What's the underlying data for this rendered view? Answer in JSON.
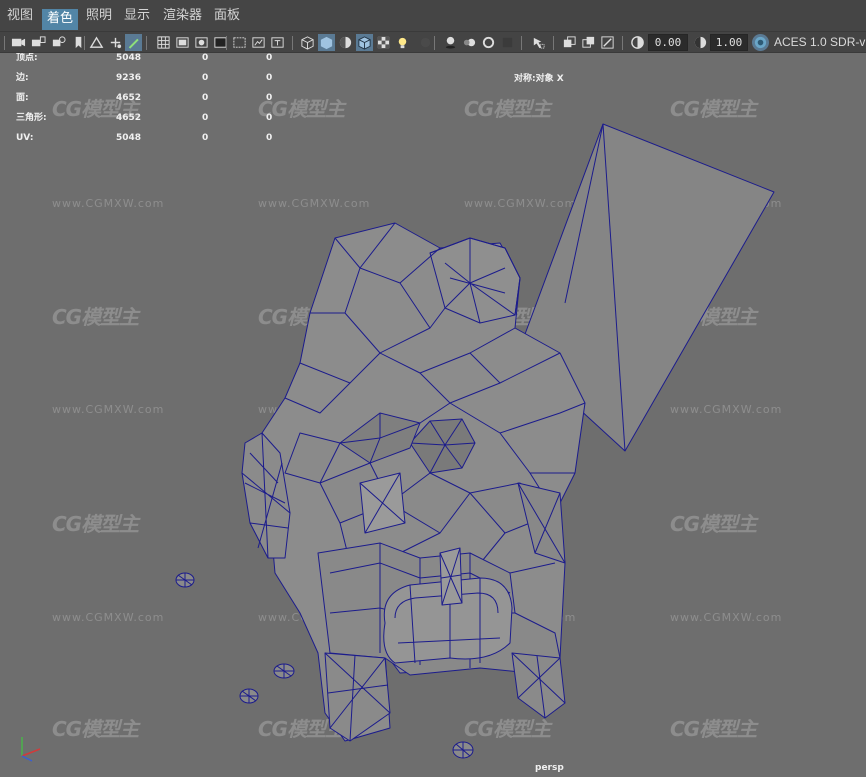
{
  "menu": [
    "视图",
    "着色",
    "照明",
    "显示",
    "渲染器",
    "面板"
  ],
  "menu_active_index": 1,
  "toolbar": {
    "exposure": "0.00",
    "gamma": "1.00",
    "color_transform": "ACES 1.0 SDR-v"
  },
  "hud": {
    "rows": [
      {
        "label": "顶点:",
        "v1": "5048",
        "v2": "0",
        "v3": "0"
      },
      {
        "label": "边:",
        "v1": "9236",
        "v2": "0",
        "v3": "0"
      },
      {
        "label": "面:",
        "v1": "4652",
        "v2": "0",
        "v3": "0"
      },
      {
        "label": "三角形:",
        "v1": "4652",
        "v2": "0",
        "v3": "0"
      },
      {
        "label": "UV:",
        "v1": "5048",
        "v2": "0",
        "v3": "0"
      }
    ],
    "symmetry": "对称:对象 X"
  },
  "camera_label": "persp",
  "watermark": {
    "logo": "CG模型主",
    "url": "www.CGMXW.com"
  },
  "colors": {
    "wire": "#1c1c8c",
    "mesh": "#8a8a8a",
    "bg": "#6e6e6e",
    "menu_active": "#5285a6"
  }
}
